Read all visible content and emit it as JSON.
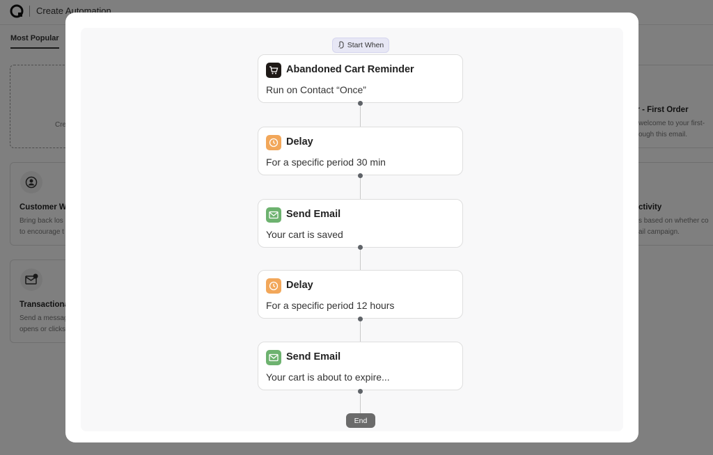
{
  "background": {
    "title": "Create Automation",
    "tab": "Most Popular",
    "cards": [
      {
        "title": "",
        "text_lines": [
          "Cre"
        ]
      },
      {
        "title": "Customer W",
        "text_lines": [
          "Bring back los",
          "to encourage t"
        ]
      },
      {
        "title": "Transactiona",
        "text_lines": [
          "Send a messag",
          "opens or clicks"
        ]
      },
      {
        "title": "ner - First Order",
        "text_lines": [
          "welcome to your first-",
          "ough this email."
        ]
      },
      {
        "title": "ctivity",
        "text_lines": [
          "s based on whether co",
          "ail campaign."
        ]
      }
    ]
  },
  "flow": {
    "start_label": "Start When",
    "end_label": "End",
    "steps": [
      {
        "title": "Abandoned Cart Reminder",
        "subtitle": "Run on Contact “Once”",
        "icon": "cart-icon"
      },
      {
        "title": "Delay",
        "subtitle": "For a specific period 30 min",
        "icon": "clock-icon"
      },
      {
        "title": "Send Email",
        "subtitle": "Your cart is saved",
        "icon": "mail-icon"
      },
      {
        "title": "Delay",
        "subtitle": "For a specific period 12 hours",
        "icon": "clock-icon"
      },
      {
        "title": "Send Email",
        "subtitle": "Your cart is about to expire...",
        "icon": "mail-icon"
      }
    ]
  },
  "colors": {
    "delay": "#f2a75a",
    "email": "#6db26f",
    "trigger": "#1f1a17",
    "start_pill": "#e7e7f5",
    "end_pill": "#6b6b6b"
  }
}
